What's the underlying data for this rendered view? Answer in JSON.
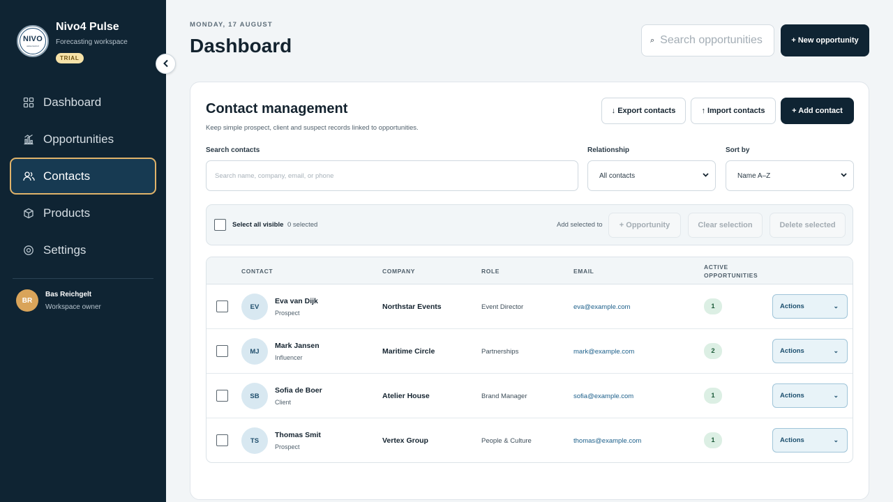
{
  "brand": {
    "logo_text": "NIVO",
    "logo_sub": "www.nivo4.nl",
    "name": "Nivo4 Pulse",
    "subtitle": "Forecasting workspace",
    "badge": "TRIAL"
  },
  "nav": {
    "items": [
      {
        "label": "Dashboard",
        "icon": "grid-icon"
      },
      {
        "label": "Opportunities",
        "icon": "bar-chart-icon"
      },
      {
        "label": "Contacts",
        "icon": "users-icon"
      },
      {
        "label": "Products",
        "icon": "box-icon"
      },
      {
        "label": "Settings",
        "icon": "gear-icon"
      }
    ],
    "active": "Contacts"
  },
  "user": {
    "initials": "BR",
    "name": "Bas Reichgelt",
    "role": "Workspace owner"
  },
  "header": {
    "date": "MONDAY, 17 AUGUST",
    "title": "Dashboard",
    "search_placeholder": "Search opportunities",
    "new_opportunity": "+ New opportunity"
  },
  "contacts": {
    "title": "Contact management",
    "subtitle": "Keep simple prospect, client and suspect records linked to opportunities.",
    "export_label": "↓ Export contacts",
    "import_label": "↑ Import contacts",
    "add_label": "+ Add contact",
    "search_label": "Search contacts",
    "search_placeholder": "Search name, company, email, or phone",
    "relationship_label": "Relationship",
    "relationship_value": "All contacts",
    "sort_label": "Sort by",
    "sort_value": "Name A–Z",
    "bulk": {
      "select_all": "Select all visible",
      "selected_count": "0 selected",
      "add_to": "Add selected to",
      "opportunity_btn": "+ Opportunity",
      "clear_btn": "Clear selection",
      "delete_btn": "Delete selected"
    },
    "columns": {
      "contact": "CONTACT",
      "company": "COMPANY",
      "role": "ROLE",
      "email": "EMAIL",
      "active_line1": "ACTIVE",
      "active_line2": "OPPORTUNITIES"
    },
    "rows": [
      {
        "initials": "EV",
        "name": "Eva van Dijk",
        "type": "Prospect",
        "company": "Northstar Events",
        "role": "Event Director",
        "email": "eva@example.com",
        "active": "1",
        "actions": "Actions"
      },
      {
        "initials": "MJ",
        "name": "Mark Jansen",
        "type": "Influencer",
        "company": "Maritime Circle",
        "role": "Partnerships",
        "email": "mark@example.com",
        "active": "2",
        "actions": "Actions"
      },
      {
        "initials": "SB",
        "name": "Sofia de Boer",
        "type": "Client",
        "company": "Atelier House",
        "role": "Brand Manager",
        "email": "sofia@example.com",
        "active": "1",
        "actions": "Actions"
      },
      {
        "initials": "TS",
        "name": "Thomas Smit",
        "type": "Prospect",
        "company": "Vertex Group",
        "role": "People & Culture",
        "email": "thomas@example.com",
        "active": "1",
        "actions": "Actions"
      }
    ]
  },
  "colors": {
    "sidebar": "#0f2433",
    "accent": "#e0b36a",
    "primary_button": "#0f2433",
    "link": "#1c5f8a",
    "badge_green": "#dcefe4"
  }
}
